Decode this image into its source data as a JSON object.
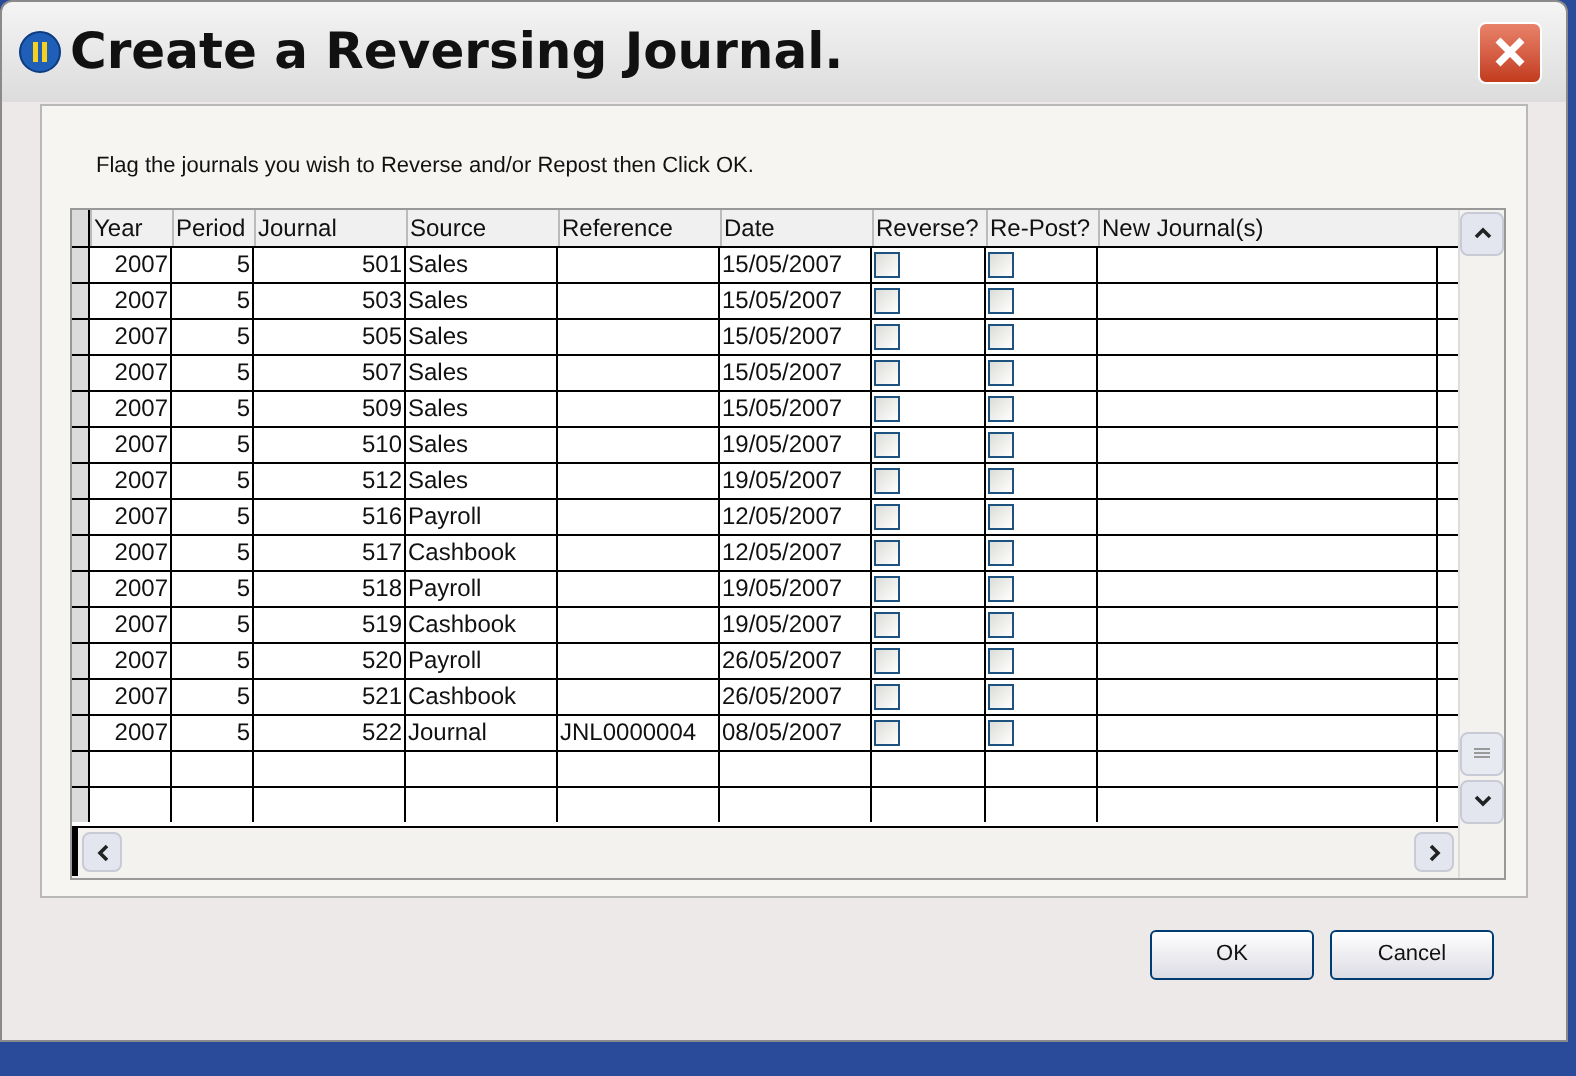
{
  "window": {
    "title": "Create a Reversing Journal."
  },
  "instruction": "Flag the journals you wish to Reverse and/or Repost then Click OK.",
  "table": {
    "columns": [
      "Year",
      "Period",
      "Journal",
      "Source",
      "Reference",
      "Date",
      "Reverse?",
      "Re-Post?",
      "New Journal(s)"
    ],
    "rows": [
      {
        "year": "2007",
        "period": "5",
        "journal": "501",
        "source": "Sales",
        "reference": "",
        "date": "15/05/2007",
        "reverse": false,
        "repost": false
      },
      {
        "year": "2007",
        "period": "5",
        "journal": "503",
        "source": "Sales",
        "reference": "",
        "date": "15/05/2007",
        "reverse": false,
        "repost": false
      },
      {
        "year": "2007",
        "period": "5",
        "journal": "505",
        "source": "Sales",
        "reference": "",
        "date": "15/05/2007",
        "reverse": false,
        "repost": false
      },
      {
        "year": "2007",
        "period": "5",
        "journal": "507",
        "source": "Sales",
        "reference": "",
        "date": "15/05/2007",
        "reverse": false,
        "repost": false
      },
      {
        "year": "2007",
        "period": "5",
        "journal": "509",
        "source": "Sales",
        "reference": "",
        "date": "15/05/2007",
        "reverse": false,
        "repost": false
      },
      {
        "year": "2007",
        "period": "5",
        "journal": "510",
        "source": "Sales",
        "reference": "",
        "date": "19/05/2007",
        "reverse": false,
        "repost": false
      },
      {
        "year": "2007",
        "period": "5",
        "journal": "512",
        "source": "Sales",
        "reference": "",
        "date": "19/05/2007",
        "reverse": false,
        "repost": false
      },
      {
        "year": "2007",
        "period": "5",
        "journal": "516",
        "source": "Payroll",
        "reference": "",
        "date": "12/05/2007",
        "reverse": false,
        "repost": false
      },
      {
        "year": "2007",
        "period": "5",
        "journal": "517",
        "source": "Cashbook",
        "reference": "",
        "date": "12/05/2007",
        "reverse": false,
        "repost": false
      },
      {
        "year": "2007",
        "period": "5",
        "journal": "518",
        "source": "Payroll",
        "reference": "",
        "date": "19/05/2007",
        "reverse": false,
        "repost": false
      },
      {
        "year": "2007",
        "period": "5",
        "journal": "519",
        "source": "Cashbook",
        "reference": "",
        "date": "19/05/2007",
        "reverse": false,
        "repost": false
      },
      {
        "year": "2007",
        "period": "5",
        "journal": "520",
        "source": "Payroll",
        "reference": "",
        "date": "26/05/2007",
        "reverse": false,
        "repost": false
      },
      {
        "year": "2007",
        "period": "5",
        "journal": "521",
        "source": "Cashbook",
        "reference": "",
        "date": "26/05/2007",
        "reverse": false,
        "repost": false
      },
      {
        "year": "2007",
        "period": "5",
        "journal": "522",
        "source": "Journal",
        "reference": "JNL0000004",
        "date": "08/05/2007",
        "reverse": false,
        "repost": false
      }
    ]
  },
  "buttons": [
    "OK",
    "Cancel"
  ]
}
